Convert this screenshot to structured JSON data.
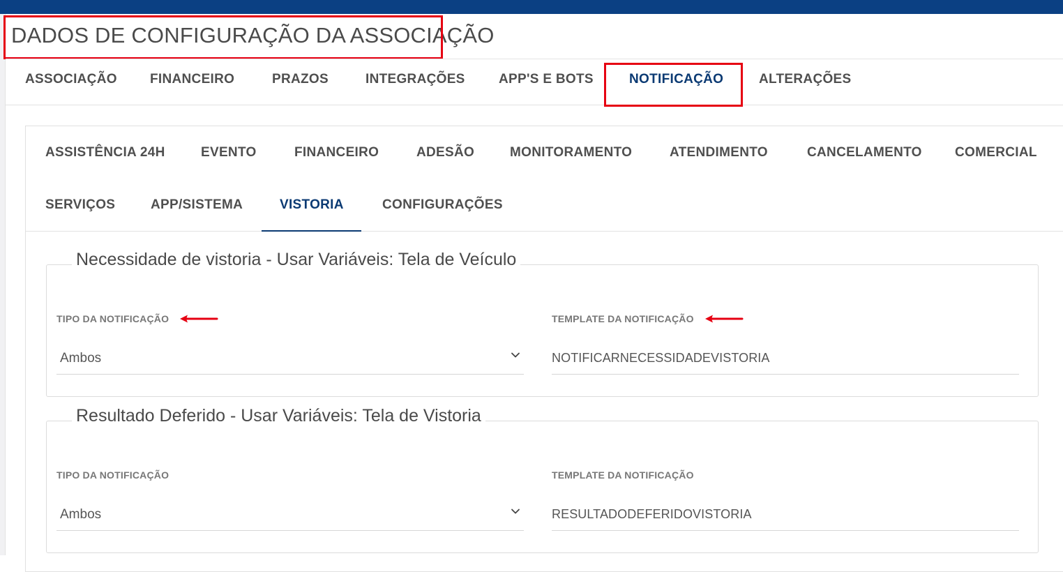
{
  "page": {
    "title": "DADOS DE CONFIGURAÇÃO DA ASSOCIAÇÃO"
  },
  "main_tabs": [
    {
      "label": "ASSOCIAÇÃO"
    },
    {
      "label": "FINANCEIRO"
    },
    {
      "label": "PRAZOS"
    },
    {
      "label": "INTEGRAÇÕES"
    },
    {
      "label": "APP'S E BOTS"
    },
    {
      "label": "NOTIFICAÇÃO",
      "active": true
    },
    {
      "label": "ALTERAÇÕES"
    }
  ],
  "sub_tabs": [
    {
      "label": "ASSISTÊNCIA 24H"
    },
    {
      "label": "EVENTO"
    },
    {
      "label": "FINANCEIRO"
    },
    {
      "label": "ADESÃO"
    },
    {
      "label": "MONITORAMENTO"
    },
    {
      "label": "ATENDIMENTO"
    },
    {
      "label": "CANCELAMENTO"
    },
    {
      "label": "COMERCIAL"
    },
    {
      "label": "SERVIÇOS"
    },
    {
      "label": "APP/SISTEMA"
    },
    {
      "label": "VISTORIA",
      "active": true
    },
    {
      "label": "CONFIGURAÇÕES"
    }
  ],
  "sections": [
    {
      "title": "Necessidade de vistoria - Usar Variáveis: Tela de Veículo",
      "tipo_label": "TIPO DA NOTIFICAÇÃO",
      "tipo_value": "Ambos",
      "template_label": "TEMPLATE DA NOTIFICAÇÃO",
      "template_value": "NOTIFICARNECESSIDADEVISTORIA"
    },
    {
      "title": "Resultado Deferido - Usar Variáveis: Tela de Vistoria",
      "tipo_label": "TIPO DA NOTIFICAÇÃO",
      "tipo_value": "Ambos",
      "template_label": "TEMPLATE DA NOTIFICAÇÃO",
      "template_value": "RESULTADODEFERIDOVISTORIA"
    }
  ],
  "colors": {
    "topbar": "#0b4083",
    "active_tab": "#0b3a73",
    "annotation_red": "#e60012"
  }
}
